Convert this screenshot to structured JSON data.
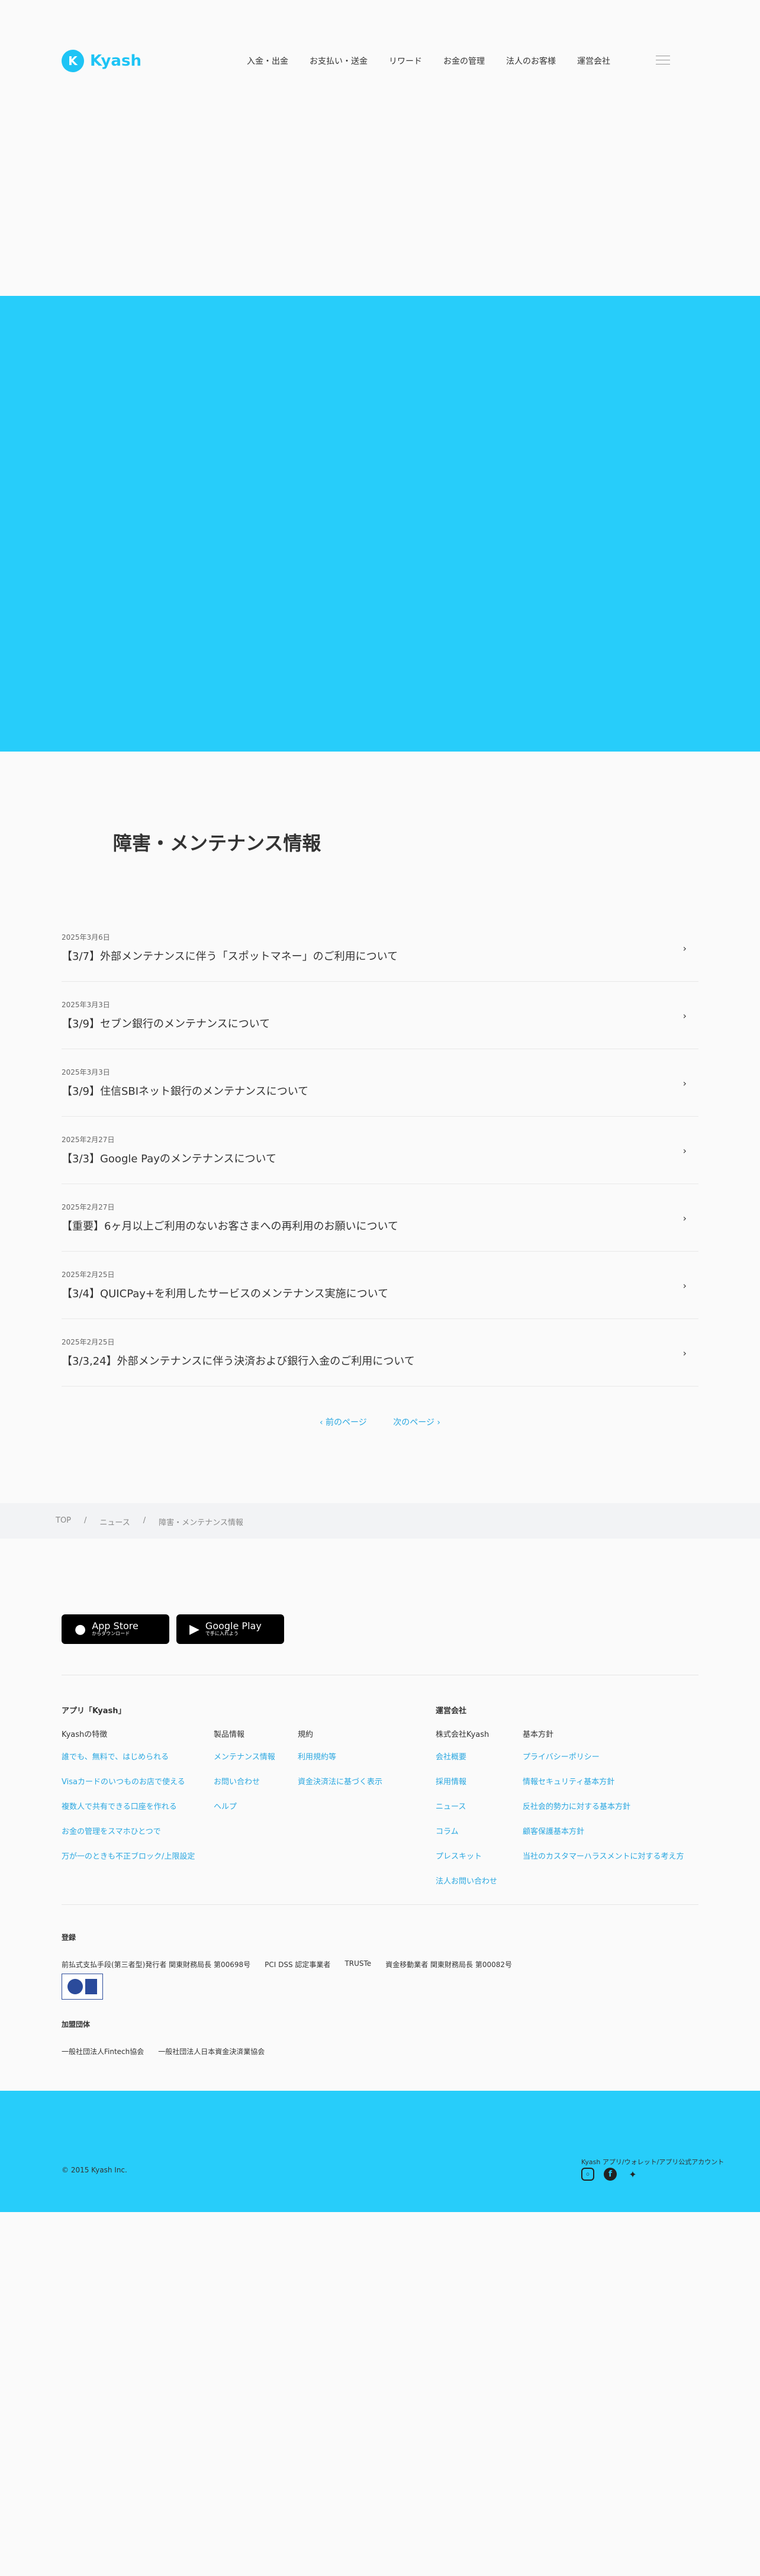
{
  "header": {
    "logo_mark": "K",
    "logo_text": "Kyash",
    "nav": [
      "入金・出金",
      "お支払い・送金",
      "リワード",
      "お金の管理",
      "法人のお客様",
      "運営会社"
    ]
  },
  "news": {
    "title": "障害・メンテナンス情報",
    "items": [
      {
        "date": "2025年3月6日",
        "title": "【3/7】外部メンテナンスに伴う「スポットマネー」のご利用について"
      },
      {
        "date": "2025年3月3日",
        "title": "【3/9】セブン銀行のメンテナンスについて"
      },
      {
        "date": "2025年3月3日",
        "title": "【3/9】住信SBIネット銀行のメンテナンスについて"
      },
      {
        "date": "2025年2月27日",
        "title": "【3/3】Google Payのメンテナンスについて"
      },
      {
        "date": "2025年2月27日",
        "title": "【重要】6ヶ月以上ご利用のないお客さまへの再利用のお願いについて"
      },
      {
        "date": "2025年2月25日",
        "title": "【3/4】QUICPay+を利用したサービスのメンテナンス実施について"
      },
      {
        "date": "2025年2月25日",
        "title": "【3/3,24】外部メンテナンスに伴う決済および銀行入金のご利用について"
      }
    ],
    "prev_label": "‹ 前のページ",
    "next_label": "次のページ ›"
  },
  "breadcrumb": [
    "TOP",
    "/",
    "ニュース",
    "/",
    "障害・メンテナンス情報"
  ],
  "footer": {
    "app_store": {
      "big": "App Store",
      "small": "からダウンロード"
    },
    "google_play": {
      "big": "Google Play",
      "small": "で手に入れよう"
    },
    "col_app_head": "アプリ「Kyash」",
    "col_company_head": "運営会社",
    "features_head": "Kyashの特徴",
    "features": [
      "誰でも、無料で、はじめられる",
      "Visaカードのいつものお店で使える",
      "複数人で共有できる口座を作れる",
      "お金の管理をスマホひとつで",
      "万が一のときも不正ブロック/上限設定"
    ],
    "products_head": "製品情報",
    "products": [
      "メンテナンス情報",
      "お問い合わせ",
      "ヘルプ"
    ],
    "terms_head": "規約",
    "terms": [
      "利用規約等",
      "資金決済法に基づく表示"
    ],
    "company_sub": "株式会社Kyash",
    "company": [
      "会社概要",
      "採用情報",
      "ニュース",
      "コラム",
      "プレスキット",
      "法人お問い合わせ"
    ],
    "policy_head": "基本方針",
    "policy": [
      "プライバシーポリシー",
      "情報セキュリティ基本方針",
      "反社会的勢力に対する基本方針",
      "顧客保護基本方針",
      "当社のカスタマーハラスメントに対する考え方"
    ],
    "reg_head": "登録",
    "reg_items": [
      "前払式支払手段(第三者型)発行者 関東財務局長 第00698号",
      "PCI DSS 認定事業者",
      "TRUSTe",
      "資金移動業者 関東財務局長 第00082号"
    ],
    "member_head": "加盟団体",
    "member_items": [
      "一般社団法人Fintech協会",
      "一般社団法人日本資金決済業協会"
    ],
    "copyright": "© 2015 Kyash Inc.",
    "social_label": "Kyash アプリ/ウォレット/アプリ公式アカウント",
    "social_icons": [
      "instagram-icon",
      "facebook-icon",
      "twitter-icon"
    ]
  }
}
